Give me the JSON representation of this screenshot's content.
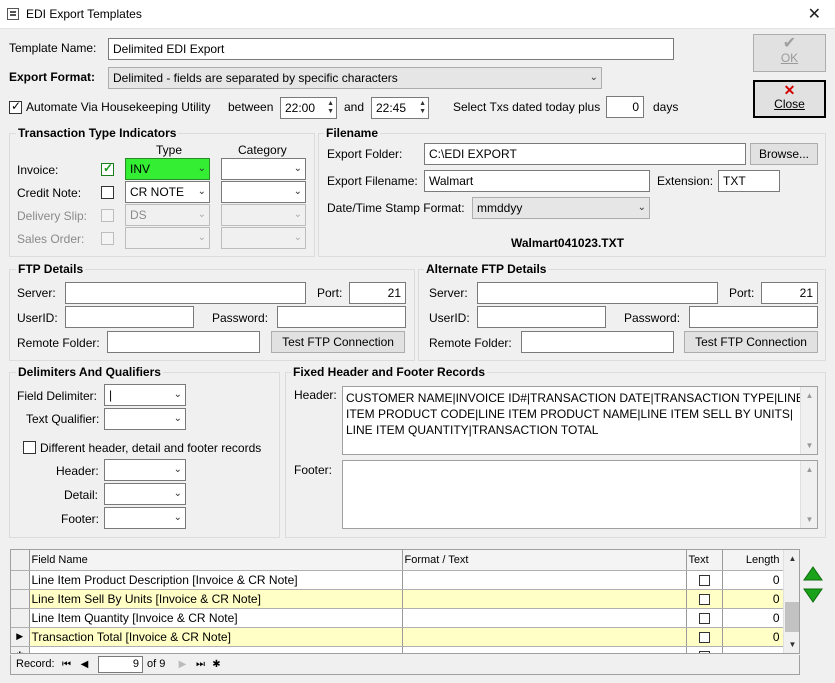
{
  "window": {
    "title": "EDI Export Templates",
    "close_glyph": "✕"
  },
  "template_name": {
    "label": "Template Name:",
    "value": "Delimited EDI Export"
  },
  "export_format": {
    "label": "Export Format:",
    "value": "Delimited - fields are separated by specific characters"
  },
  "automation": {
    "label": "Automate Via Housekeeping Utility",
    "between_label": "between",
    "start_time": "22:00",
    "and_label": "and",
    "end_time": "22:45",
    "select_label": "Select Txs dated today plus",
    "days_value": "0",
    "days_label": "days"
  },
  "buttons": {
    "ok": "OK",
    "close": "Close",
    "browse": "Browse...",
    "test_ftp": "Test FTP Connection"
  },
  "transaction_types": {
    "title": "Transaction Type Indicators",
    "type_header": "Type",
    "category_header": "Category",
    "rows": [
      {
        "label": "Invoice:",
        "type": "INV"
      },
      {
        "label": "Credit Note:",
        "type": "CR NOTE"
      },
      {
        "label": "Delivery Slip:",
        "type": "DS"
      },
      {
        "label": "Sales Order:",
        "type": ""
      }
    ]
  },
  "filename": {
    "title": "Filename",
    "folder_label": "Export Folder:",
    "folder_value": "C:\\EDI EXPORT",
    "filename_label": "Export Filename:",
    "filename_value": "Walmart",
    "extension_label": "Extension:",
    "extension_value": "TXT",
    "stamp_label": "Date/Time Stamp Format:",
    "stamp_value": "mmddyy",
    "preview": "Walmart041023.TXT"
  },
  "ftp": {
    "title": "FTP Details",
    "server_label": "Server:",
    "port_label": "Port:",
    "port_value": "21",
    "userid_label": "UserID:",
    "password_label": "Password:",
    "remote_label": "Remote Folder:"
  },
  "alt_ftp": {
    "title": "Alternate FTP Details",
    "server_label": "Server:",
    "port_label": "Port:",
    "port_value": "21",
    "userid_label": "UserID:",
    "password_label": "Password:",
    "remote_label": "Remote Folder:"
  },
  "delimiters": {
    "title": "Delimiters And Qualifiers",
    "field_label": "Field Delimiter:",
    "field_value": "|",
    "text_label": "Text Qualifier:",
    "different_label": "Different header, detail and footer records",
    "header_label": "Header:",
    "detail_label": "Detail:",
    "footer_label": "Footer:"
  },
  "fixed_records": {
    "title": "Fixed Header and Footer Records",
    "header_label": "Header:",
    "header_lines": [
      "CUSTOMER NAME|INVOICE ID#|TRANSACTION DATE|TRANSACTION TYPE|LINE",
      "ITEM PRODUCT CODE|LINE ITEM PRODUCT NAME|LINE ITEM SELL BY UNITS|",
      "LINE ITEM QUANTITY|TRANSACTION TOTAL"
    ],
    "footer_label": "Footer:"
  },
  "grid": {
    "columns": [
      "Field Name",
      "Format / Text",
      "Text",
      "Length"
    ],
    "rows": [
      {
        "name": "Line Item Product Description [Invoice & CR Note]",
        "format": "",
        "length": "0",
        "style": "white"
      },
      {
        "name": "Line Item Sell By Units [Invoice & CR Note]",
        "format": "",
        "length": "0",
        "style": "yellow"
      },
      {
        "name": "Line Item Quantity [Invoice & CR Note]",
        "format": "",
        "length": "0",
        "style": "white"
      },
      {
        "name": "Transaction Total [Invoice & CR Note]",
        "format": "",
        "length": "0",
        "style": "yellow"
      }
    ]
  },
  "record_nav": {
    "label": "Record:",
    "current": "9",
    "of_label": "of 9"
  },
  "colors": {
    "green_field": "#33ee33",
    "yellow_row": "#ffffc6",
    "move_arrows": "#1aa31a",
    "close_x": "#d40000"
  }
}
